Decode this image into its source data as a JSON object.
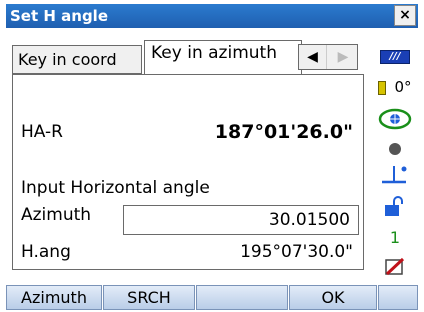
{
  "window": {
    "title": "Set H angle",
    "close_label": "×"
  },
  "tabs": [
    {
      "label": "Key in coord"
    },
    {
      "label": "Key in azimuth"
    }
  ],
  "tabnav": {
    "prev_icon": "◀",
    "next_icon": "▶"
  },
  "main": {
    "har_label": "HA-R",
    "har_value": "187°01'26.0\"",
    "input_heading": "Input Horizontal angle",
    "azimuth_label": "Azimuth",
    "azimuth_value": "30.01500",
    "hang_label": "H.ang",
    "hang_value": "195°07'30.0\""
  },
  "status": {
    "battery_icon": "battery-icon",
    "battery_text": "///",
    "tilt_text": "0°",
    "counter_text": "1"
  },
  "softkeys": [
    {
      "label": "Azimuth"
    },
    {
      "label": "SRCH"
    },
    {
      "label": ""
    },
    {
      "label": "OK"
    },
    {
      "label": ""
    }
  ]
}
